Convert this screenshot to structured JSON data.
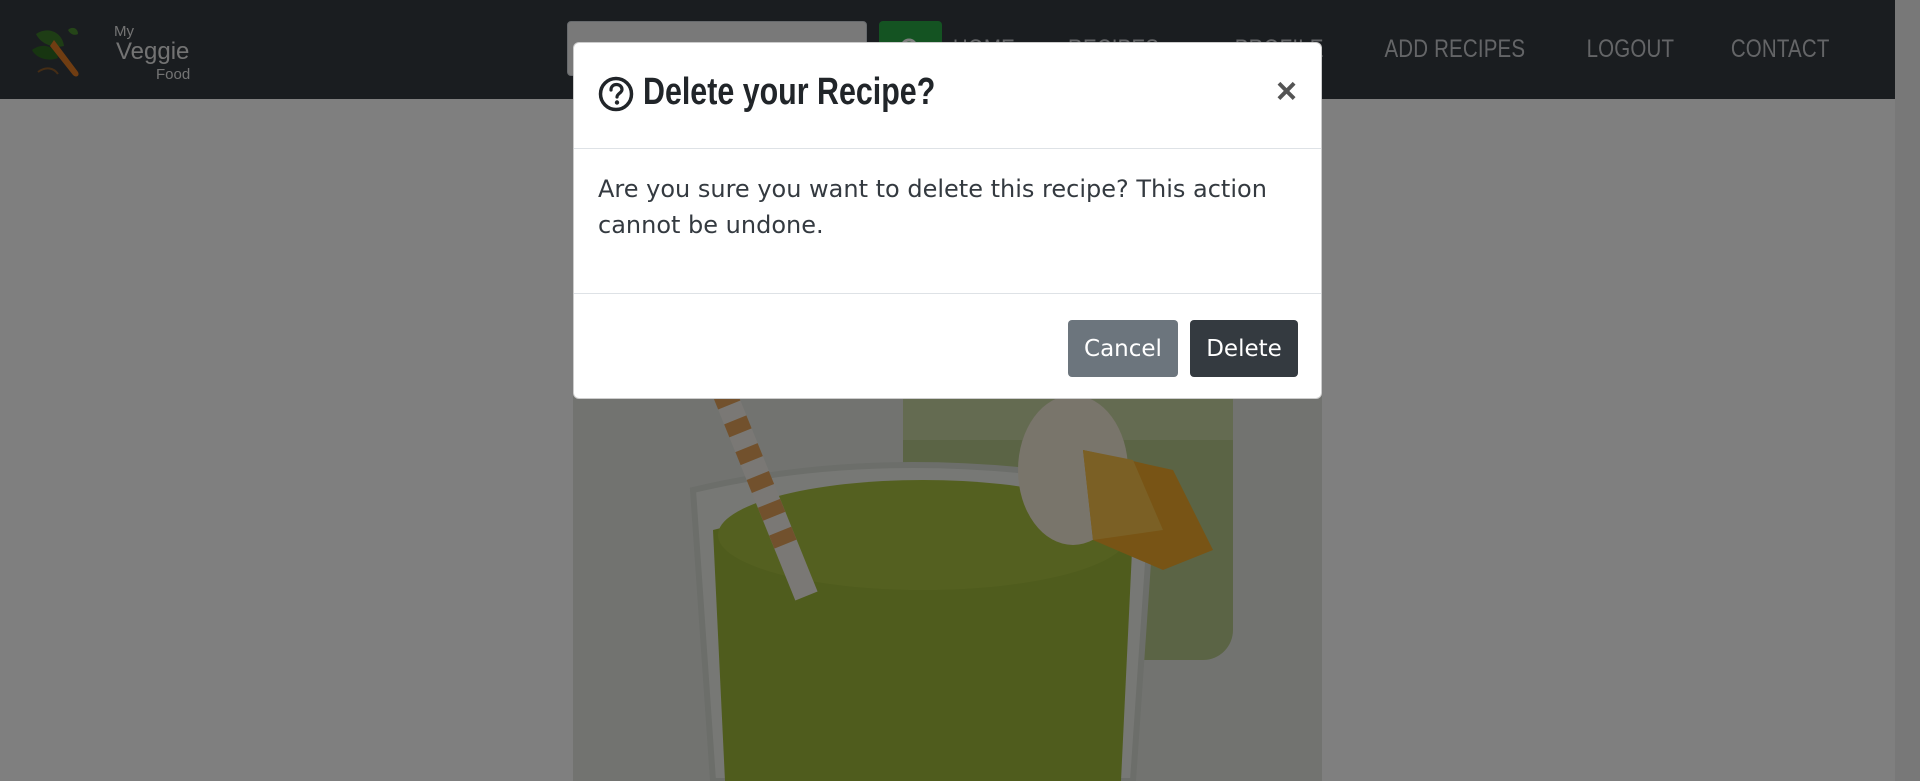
{
  "brand": {
    "line1": "My",
    "line2": "Veggie",
    "line3": "Food",
    "logo_icon": "carrot-leaf-logo"
  },
  "search": {
    "placeholder": "",
    "button_icon": "search-icon",
    "button_color": "#28a745"
  },
  "nav": {
    "items": [
      {
        "label": "HOME"
      },
      {
        "label": "RECIPES",
        "dropdown": true
      },
      {
        "label": "PROFILE"
      },
      {
        "label": "ADD RECIPES"
      },
      {
        "label": "LOGOUT"
      },
      {
        "label": "CONTACT"
      }
    ]
  },
  "modal": {
    "title_icon": "question-circle-icon",
    "title": "Delete your Recipe?",
    "close_label": "×",
    "body": "Are you sure you want to delete this recipe? This action cannot be undone.",
    "cancel_label": "Cancel",
    "delete_label": "Delete"
  },
  "colors": {
    "navbar": "#343a40",
    "cancel": "#6c757d",
    "delete": "#343a40"
  }
}
